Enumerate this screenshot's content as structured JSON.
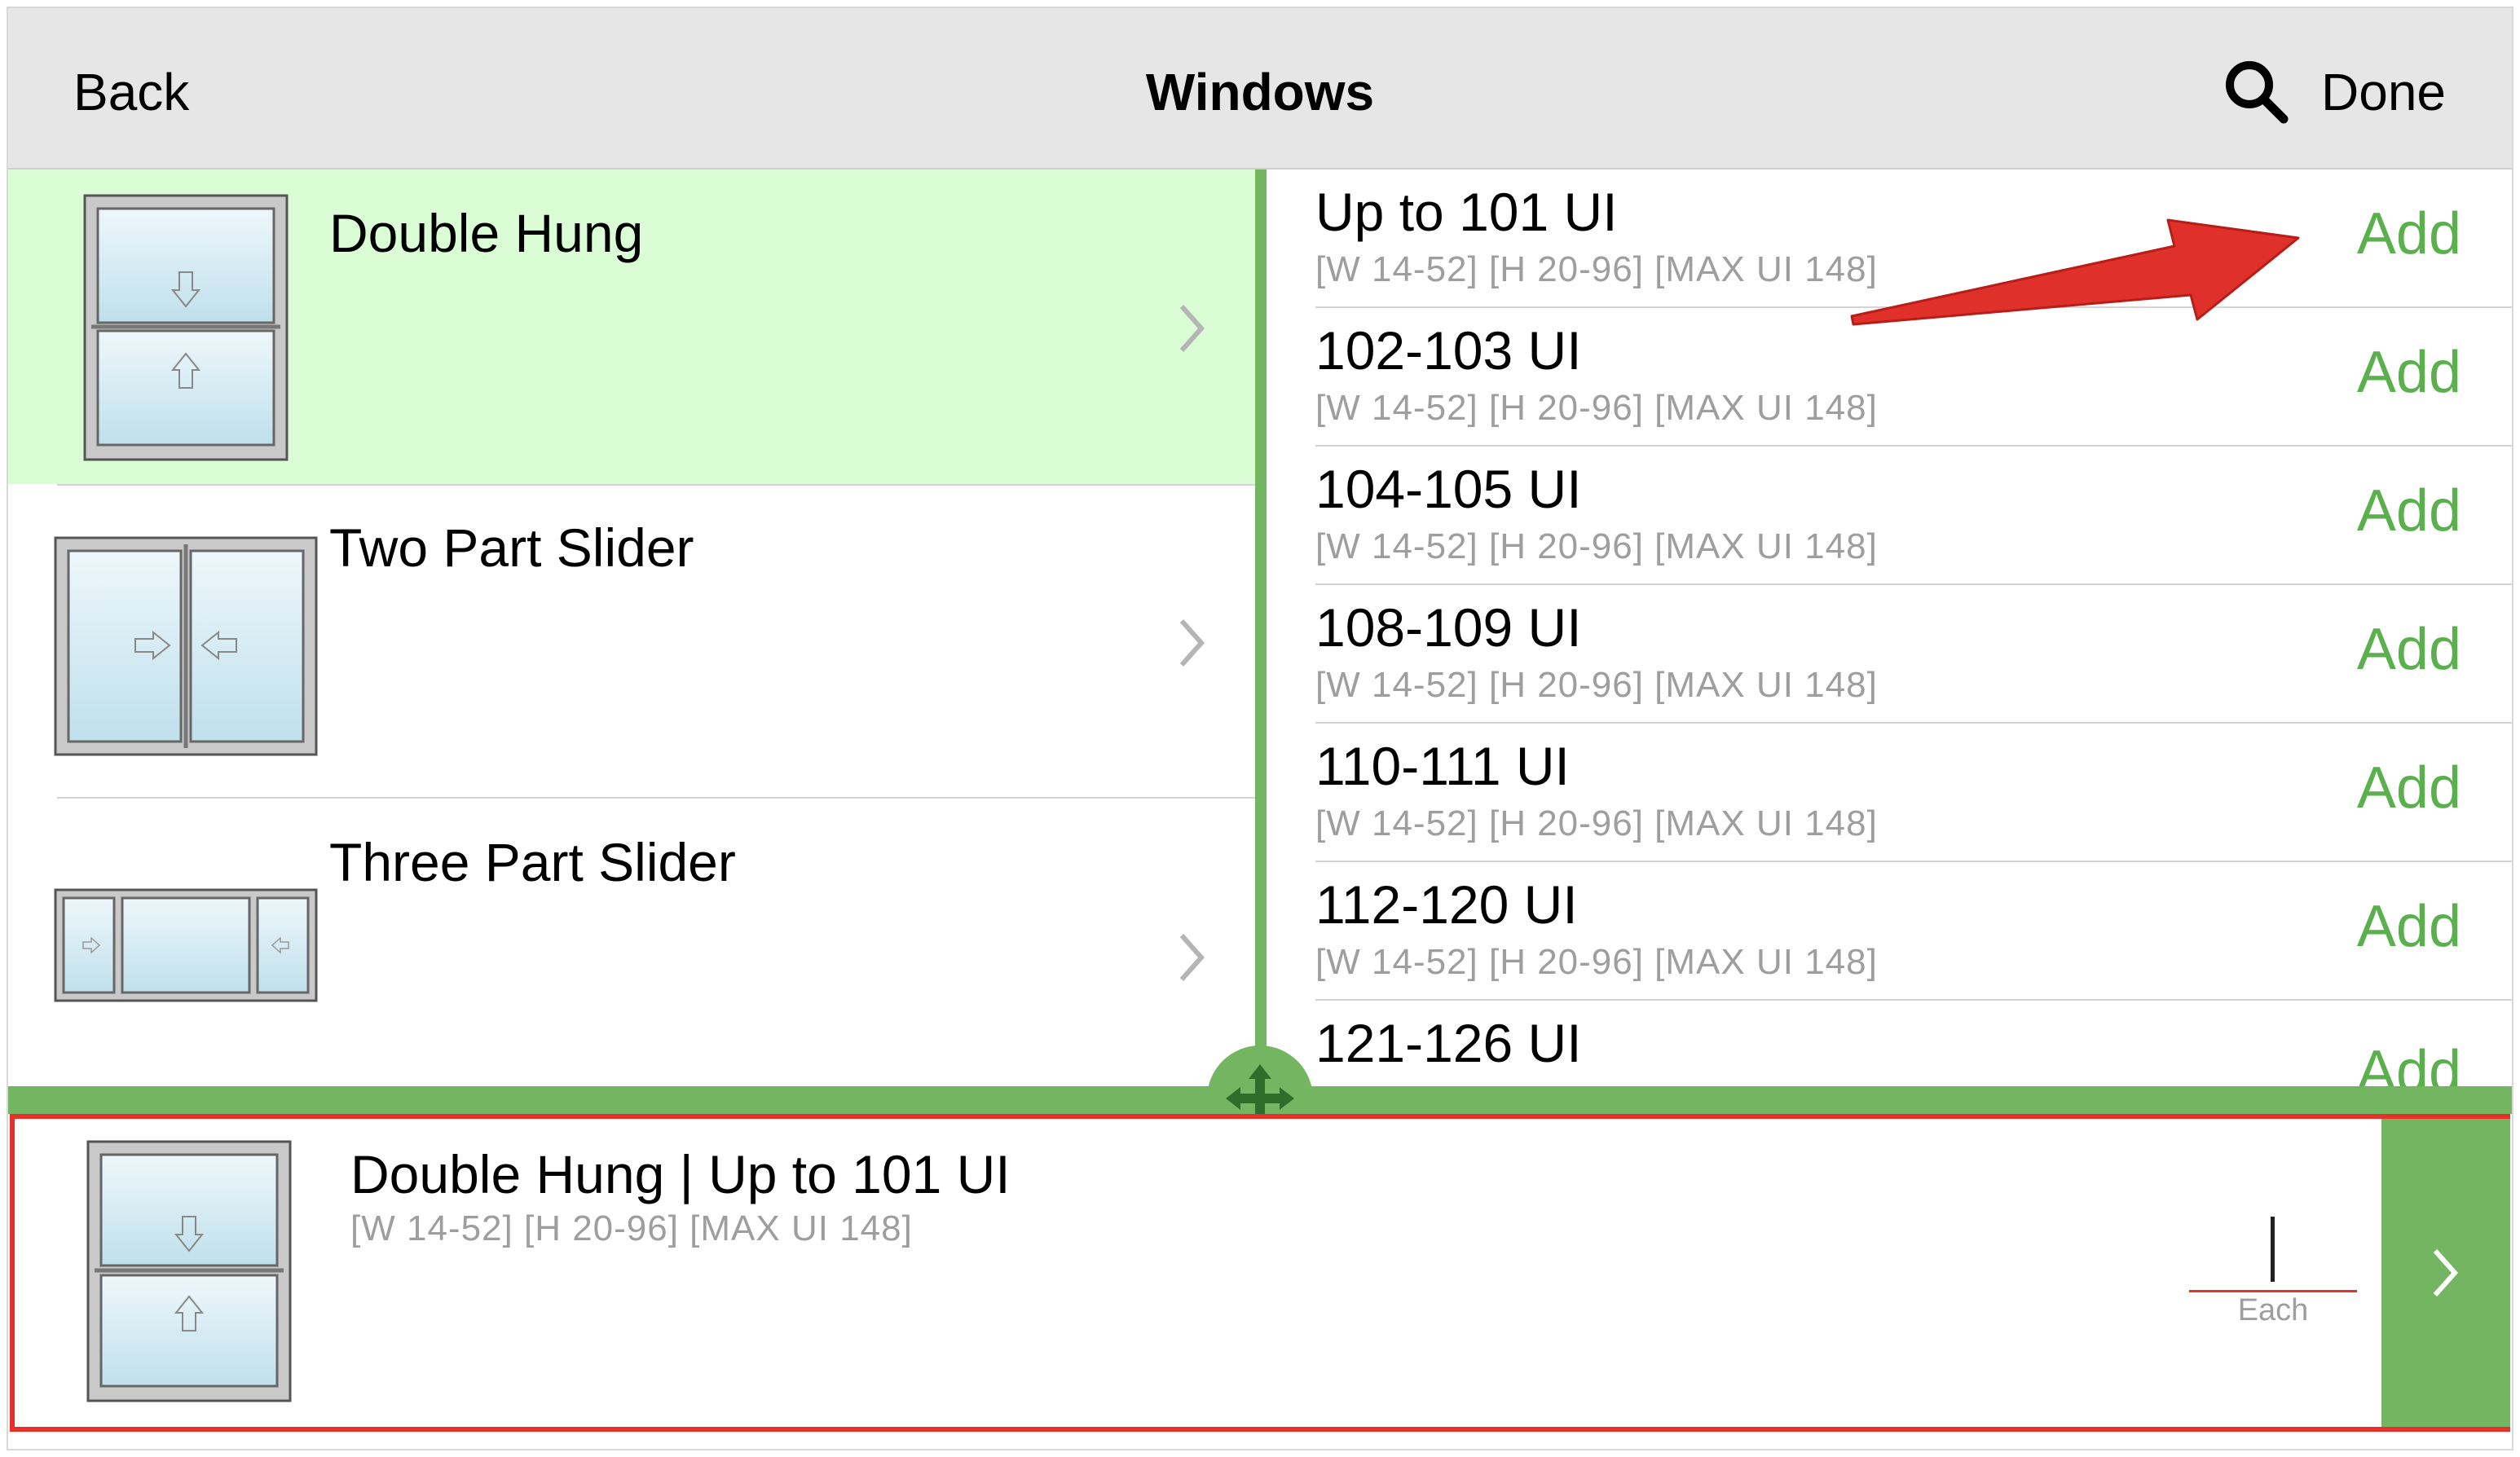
{
  "header": {
    "back_label": "Back",
    "title": "Windows",
    "search_icon": "search-icon",
    "done_label": "Done"
  },
  "categories": [
    {
      "label": "Double Hung",
      "selected": true
    },
    {
      "label": "Two Part Slider",
      "selected": false
    },
    {
      "label": "Three Part Slider",
      "selected": false
    }
  ],
  "options": [
    {
      "title": "Up to 101 UI",
      "spec": "[W 14-52] [H 20-96] [MAX UI 148]",
      "action": "Add"
    },
    {
      "title": "102-103 UI",
      "spec": "[W 14-52] [H 20-96] [MAX UI 148]",
      "action": "Add"
    },
    {
      "title": "104-105 UI",
      "spec": "[W 14-52] [H 20-96] [MAX UI 148]",
      "action": "Add"
    },
    {
      "title": "108-109 UI",
      "spec": "[W 14-52] [H 20-96] [MAX UI 148]",
      "action": "Add"
    },
    {
      "title": "110-111 UI",
      "spec": "[W 14-52] [H 20-96] [MAX UI 148]",
      "action": "Add"
    },
    {
      "title": "112-120 UI",
      "spec": "[W 14-52] [H 20-96] [MAX UI 148]",
      "action": "Add"
    },
    {
      "title": "121-126 UI",
      "spec": "",
      "action": "Add"
    }
  ],
  "selection": {
    "title": "Double Hung | Up to 101 UI",
    "spec": "[W 14-52] [H 20-96] [MAX UI 148]",
    "quantity": "",
    "unit": "Each"
  },
  "colors": {
    "accent_green": "#73b560",
    "add_green": "#5ab04c",
    "selected_row": "#dafdd6",
    "highlight_red": "#e8302a"
  }
}
